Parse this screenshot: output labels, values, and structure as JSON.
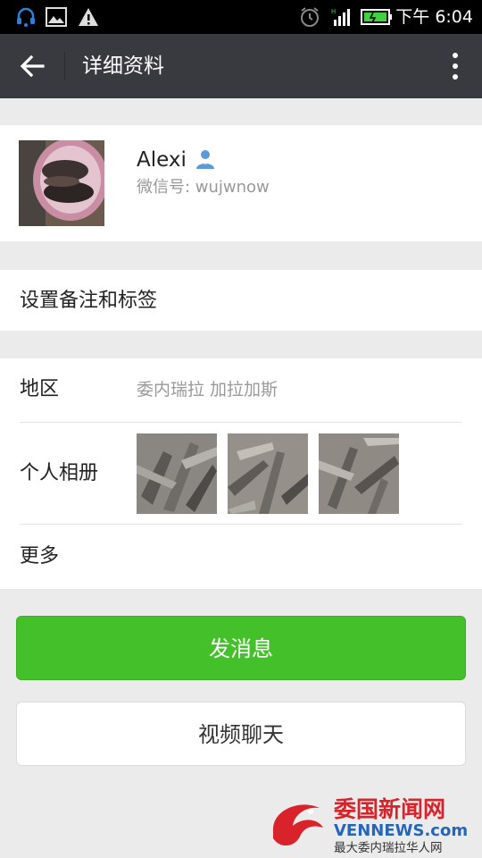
{
  "status_bar": {
    "time": "下午 6:04",
    "icons": [
      "headset-notification-icon",
      "image-notification-icon",
      "warning-icon",
      "alarm-icon",
      "signal-icon",
      "battery-icon"
    ]
  },
  "action_bar": {
    "title": "详细资料",
    "back_icon": "arrow-left-icon",
    "more_icon": "more-vertical-icon",
    "bg_color": "#393a3f"
  },
  "profile": {
    "name": "Alexi",
    "wechat_id": "微信号: wujwnow",
    "badge_icon": "person-icon"
  },
  "remark": {
    "label": "设置备注和标签"
  },
  "details": {
    "region_label": "地区",
    "region_value": "委内瑞拉  加拉加斯",
    "album_label": "个人相册",
    "more_label": "更多"
  },
  "buttons": {
    "send_message": "发消息",
    "video_chat": "视频聊天",
    "accent_color": "#44c12a"
  },
  "watermark": {
    "title": "委国新闻网",
    "domain": "VENNEWS.com",
    "tagline": "最大委内瑞拉华人网"
  }
}
